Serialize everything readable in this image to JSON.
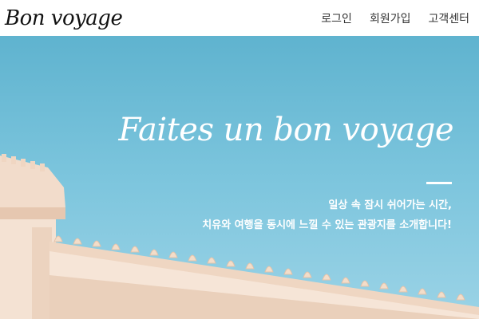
{
  "header": {
    "logo": "Bon voyage",
    "nav": [
      {
        "label": "로그인"
      },
      {
        "label": "회원가입"
      },
      {
        "label": "고객센터"
      }
    ]
  },
  "hero": {
    "title": "Faites un bon voyage",
    "line1": "일상 속 잠시 쉬어가는 시간,",
    "line2": "치유와 여행을 동시에 느낄 수 있는 관광지를 소개합니다!"
  },
  "colors": {
    "sky": "#7cc5dd",
    "building": "#efd9c6",
    "text_light": "#ffffff"
  }
}
